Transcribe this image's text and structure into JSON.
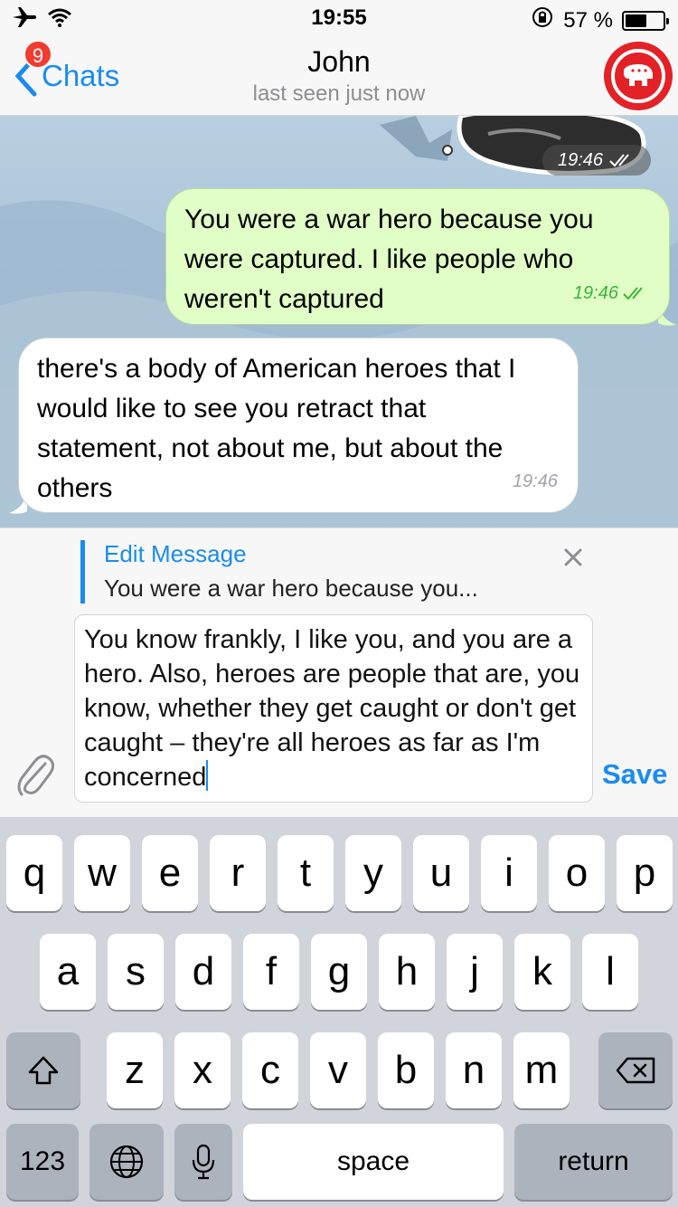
{
  "status_bar": {
    "time": "19:55",
    "battery_percent": "57 %",
    "battery_level": 0.57
  },
  "nav": {
    "back_label": "Chats",
    "unread_badge": "9",
    "title": "John",
    "subtitle": "last seen just now"
  },
  "messages": {
    "sticker_time": "19:46",
    "outgoing": {
      "text": "You were a war hero because you were captured. I like people who weren't captured",
      "time": "19:46",
      "read": true
    },
    "incoming": {
      "text": "there's a body of American heroes that I would like to see you retract that statement, not about me, but about the others",
      "time": "19:46"
    }
  },
  "edit": {
    "title": "Edit Message",
    "preview": "You were a war hero because you...",
    "input_text": "You know frankly, I like you, and you are a hero. Also, heroes are people that are, you know, whether they get caught or don't get caught – they're all heroes as far as I'm concerned",
    "save_label": "Save"
  },
  "keyboard": {
    "row1": [
      "q",
      "w",
      "e",
      "r",
      "t",
      "y",
      "u",
      "i",
      "o",
      "p"
    ],
    "row2": [
      "a",
      "s",
      "d",
      "f",
      "g",
      "h",
      "j",
      "k",
      "l"
    ],
    "row3": [
      "z",
      "x",
      "c",
      "v",
      "b",
      "n",
      "m"
    ],
    "numbers_label": "123",
    "space_label": "space",
    "return_label": "return"
  },
  "icons": {
    "airplane": "airplane-icon",
    "wifi": "wifi-icon",
    "orientation_lock": "orientation-lock-icon",
    "back": "chevron-left-icon",
    "attach": "paperclip-icon",
    "close": "close-icon",
    "shift": "shift-icon",
    "backspace": "backspace-icon",
    "globe": "globe-icon",
    "mic": "microphone-icon"
  },
  "colors": {
    "accent": "#1a8cf0",
    "outgoing_bubble": "#e1fec6",
    "badge": "#f23b30",
    "avatar": "#e32227"
  }
}
